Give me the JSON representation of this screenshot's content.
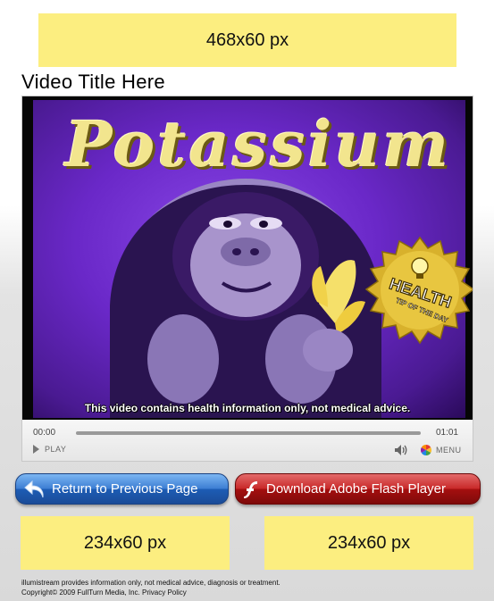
{
  "ads": {
    "top_label": "468x60 px",
    "left_label": "234x60 px",
    "right_label": "234x60 px"
  },
  "video": {
    "title": "Video Title Here",
    "frame_title": "Potassium",
    "caption": "This video contains health information only, not medical advice.",
    "badge_line1": "HEALTH",
    "badge_line2": "TIP OF THE DAY"
  },
  "player": {
    "current_time": "00:00",
    "total_time": "01:01",
    "progress": 0,
    "play_label": "PLAY",
    "menu_label": "MENU"
  },
  "buttons": {
    "return_label": "Return to Previous Page",
    "flash_label": "Download Adobe Flash Player"
  },
  "footer": {
    "line1": "illumistream provides information only, not medical advice, diagnosis or treatment.",
    "copyright": "Copyright© 2009 FullTurn Media, Inc.",
    "privacy_link": "Privacy Policy"
  },
  "colors": {
    "ad_placeholder": "#fcee80",
    "video_background": "#6a28c8",
    "return_button": "#2e6fc6",
    "flash_button": "#b51d1d"
  }
}
